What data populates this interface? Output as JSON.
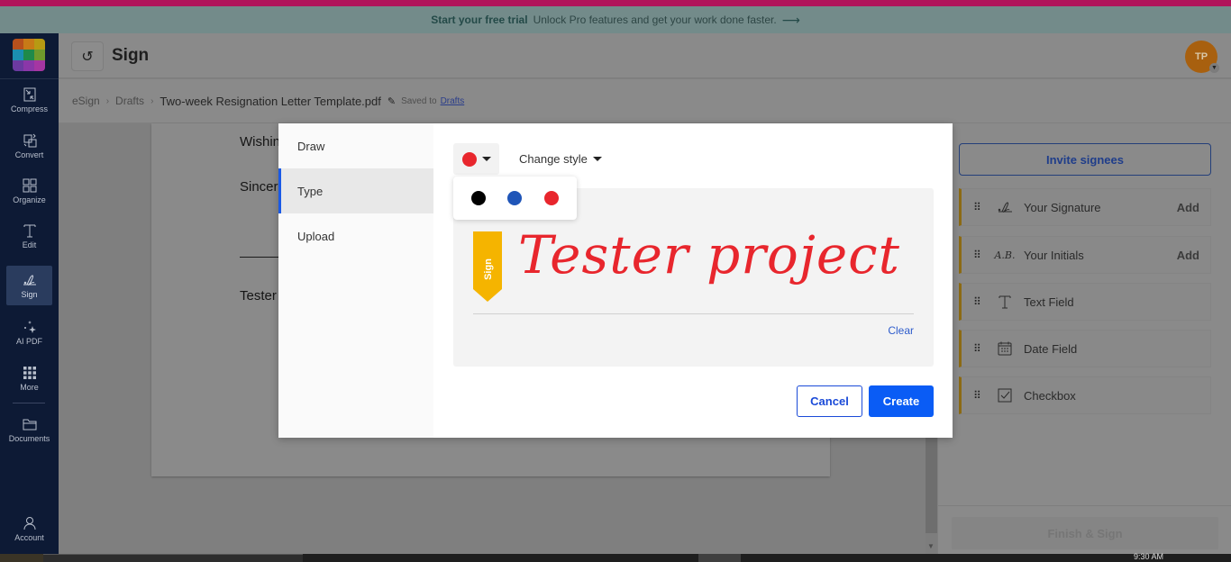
{
  "trial_banner": {
    "cta": "Start your free trial",
    "message": "Unlock Pro features and get your work done faster.",
    "arrow_icon": "arrow-right-icon"
  },
  "sidebar": {
    "logo_colors": [
      "#b6501c",
      "#c77a17",
      "#b79a13",
      "#1b8fb0",
      "#1f8a4a",
      "#6f9a2c",
      "#6b3aa0",
      "#8a37a8",
      "#a536a2"
    ],
    "items": [
      {
        "label": "Compress",
        "icon": "compress-icon",
        "active": false
      },
      {
        "label": "Convert",
        "icon": "convert-icon",
        "active": false
      },
      {
        "label": "Organize",
        "icon": "organize-icon",
        "active": false
      },
      {
        "label": "Edit",
        "icon": "edit-text-icon",
        "active": false
      },
      {
        "label": "Sign",
        "icon": "signature-icon",
        "active": true
      },
      {
        "label": "AI PDF",
        "icon": "sparkle-icon",
        "active": false
      },
      {
        "label": "More",
        "icon": "grid-dots-icon",
        "active": false
      },
      {
        "label": "Documents",
        "icon": "folder-icon",
        "active": false
      },
      {
        "label": "Account",
        "icon": "user-icon",
        "active": false
      }
    ]
  },
  "header": {
    "title": "Sign",
    "undo_icon": "undo-icon",
    "avatar_initials": "TP"
  },
  "breadcrumb": {
    "items": [
      "eSign",
      "Drafts"
    ],
    "file_name": "Two-week Resignation Letter Template.pdf",
    "saved_label": "Saved to",
    "saved_link": "Drafts"
  },
  "document": {
    "lines": [
      "Wishin",
      "Sincer",
      "Tester"
    ]
  },
  "right_panel": {
    "invite_label": "Invite signees",
    "fields": [
      {
        "label": "Your Signature",
        "icon": "signature-icon",
        "action": "Add"
      },
      {
        "label": "Your Initials",
        "icon": "initials-icon",
        "action": "Add"
      },
      {
        "label": "Text Field",
        "icon": "text-field-icon",
        "action": ""
      },
      {
        "label": "Date Field",
        "icon": "calendar-icon",
        "action": ""
      },
      {
        "label": "Checkbox",
        "icon": "checkbox-icon",
        "action": ""
      }
    ],
    "finish_label": "Finish & Sign"
  },
  "modal": {
    "tabs": [
      {
        "label": "Draw",
        "active": false
      },
      {
        "label": "Type",
        "active": true
      },
      {
        "label": "Upload",
        "active": false
      }
    ],
    "selected_color": "#e8262d",
    "color_options": [
      "#000000",
      "#1f55b8",
      "#e8262d"
    ],
    "change_style_label": "Change style",
    "sign_flag_label": "Sign",
    "signature_text": "Tester project",
    "clear_label": "Clear",
    "cancel_label": "Cancel",
    "create_label": "Create"
  },
  "taskbar": {
    "clock": "9:30 AM"
  }
}
